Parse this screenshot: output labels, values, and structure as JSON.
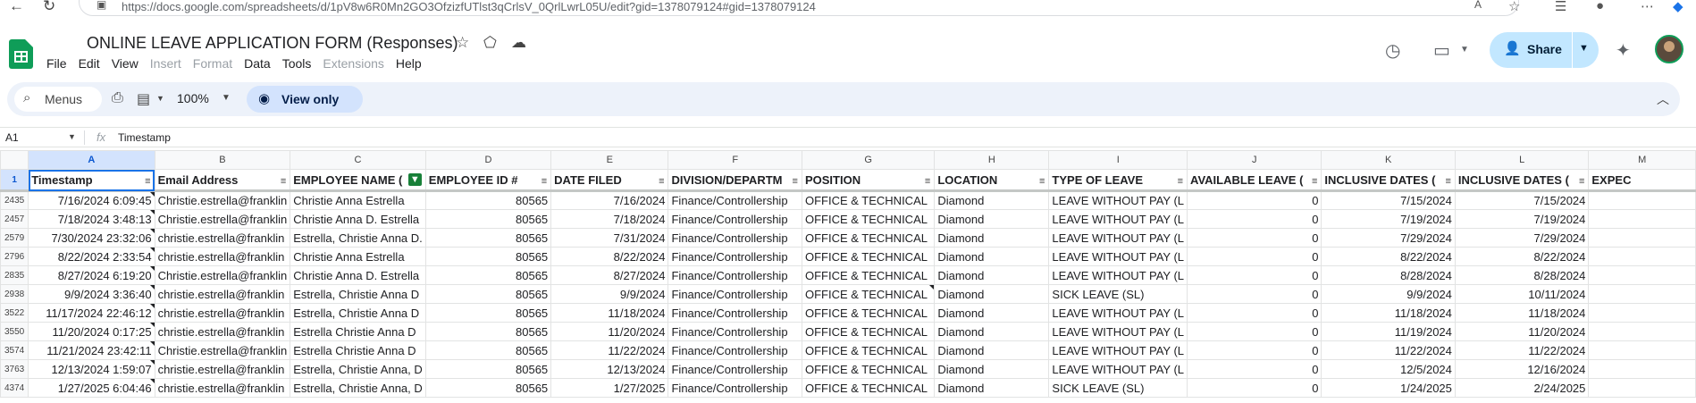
{
  "browser": {
    "url": "https://docs.google.com/spreadsheets/d/1pV8w6R0Mn2GO3OfzizfUTlst3qCrlsV_0QrlLwrL05U/edit?gid=1378079124#gid=1378079124"
  },
  "header": {
    "title": "ONLINE LEAVE APPLICATION FORM (Responses)",
    "menus": [
      "File",
      "Edit",
      "View",
      "Insert",
      "Format",
      "Data",
      "Tools",
      "Extensions",
      "Help"
    ],
    "disabled_menus": [
      "Insert",
      "Format",
      "Extensions"
    ],
    "share_label": "Share"
  },
  "toolbar": {
    "search_label": "Menus",
    "zoom": "100%",
    "view_only_label": "View only"
  },
  "formula_bar": {
    "name_box": "A1",
    "fx_label": "fx",
    "value": "Timestamp"
  },
  "sheet": {
    "columns": [
      "A",
      "B",
      "C",
      "D",
      "E",
      "F",
      "G",
      "H",
      "I",
      "J",
      "K",
      "L",
      "M"
    ],
    "header_row_number": "1",
    "headers": [
      "Timestamp",
      "Email Address",
      "EMPLOYEE NAME (",
      "EMPLOYEE ID #",
      "DATE FILED",
      "DIVISION/DEPARTM",
      "POSITION",
      "LOCATION",
      "TYPE OF LEAVE",
      "AVAILABLE LEAVE (",
      "INCLUSIVE DATES (",
      "INCLUSIVE DATES (",
      "EXPEC"
    ],
    "rows": [
      {
        "num": "2435",
        "cells": [
          "7/16/2024 6:09:45",
          "Christie.estrella@franklin",
          "Christie Anna Estrella",
          "80565",
          "7/16/2024",
          "Finance/Controllership",
          "OFFICE & TECHNICAL",
          "Diamond",
          "LEAVE WITHOUT PAY (L",
          "0",
          "7/15/2024",
          "7/15/2024",
          ""
        ]
      },
      {
        "num": "2457",
        "cells": [
          "7/18/2024 3:48:13",
          "Christie.estrella@franklin",
          "Christie Anna D. Estrella",
          "80565",
          "7/18/2024",
          "Finance/Controllership",
          "OFFICE & TECHNICAL",
          "Diamond",
          "LEAVE WITHOUT PAY (L",
          "0",
          "7/19/2024",
          "7/19/2024",
          ""
        ]
      },
      {
        "num": "2579",
        "cells": [
          "7/30/2024 23:32:06",
          "christie.estrella@franklin",
          "Estrella, Christie Anna D.",
          "80565",
          "7/31/2024",
          "Finance/Controllership",
          "OFFICE & TECHNICAL",
          "Diamond",
          "LEAVE WITHOUT PAY (L",
          "0",
          "7/29/2024",
          "7/29/2024",
          ""
        ]
      },
      {
        "num": "2796",
        "cells": [
          "8/22/2024 2:33:54",
          "christie.estrella@franklin",
          "Christie Anna Estrella",
          "80565",
          "8/22/2024",
          "Finance/Controllership",
          "OFFICE & TECHNICAL",
          "Diamond",
          "LEAVE WITHOUT PAY (L",
          "0",
          "8/22/2024",
          "8/22/2024",
          ""
        ]
      },
      {
        "num": "2835",
        "cells": [
          "8/27/2024 6:19:20",
          "Christie.estrella@franklin",
          "Christie Anna D. Estrella",
          "80565",
          "8/27/2024",
          "Finance/Controllership",
          "OFFICE & TECHNICAL",
          "Diamond",
          "LEAVE WITHOUT PAY (L",
          "0",
          "8/28/2024",
          "8/28/2024",
          ""
        ]
      },
      {
        "num": "2938",
        "cells": [
          "9/9/2024 3:36:40",
          "christie.estrella@franklin",
          "Estrella, Christie Anna D",
          "80565",
          "9/9/2024",
          "Finance/Controllership",
          "OFFICE & TECHNICAL",
          "Diamond",
          "SICK LEAVE (SL)",
          "0",
          "9/9/2024",
          "10/11/2024",
          ""
        ]
      },
      {
        "num": "3522",
        "cells": [
          "11/17/2024 22:46:12",
          "christie.estrella@franklin",
          "Estrella, Christie Anna D",
          "80565",
          "11/18/2024",
          "Finance/Controllership",
          "OFFICE & TECHNICAL",
          "Diamond",
          "LEAVE WITHOUT PAY (L",
          "0",
          "11/18/2024",
          "11/18/2024",
          ""
        ]
      },
      {
        "num": "3550",
        "cells": [
          "11/20/2024 0:17:25",
          "christie.estrella@franklin",
          "Estrella Christie Anna D",
          "80565",
          "11/20/2024",
          "Finance/Controllership",
          "OFFICE & TECHNICAL",
          "Diamond",
          "LEAVE WITHOUT PAY (L",
          "0",
          "11/19/2024",
          "11/20/2024",
          ""
        ]
      },
      {
        "num": "3574",
        "cells": [
          "11/21/2024 23:42:11",
          "Christie.estrella@franklin",
          "Estrella Christie Anna D",
          "80565",
          "11/22/2024",
          "Finance/Controllership",
          "OFFICE & TECHNICAL",
          "Diamond",
          "LEAVE WITHOUT PAY (L",
          "0",
          "11/22/2024",
          "11/22/2024",
          ""
        ]
      },
      {
        "num": "3763",
        "cells": [
          "12/13/2024 1:59:07",
          "christie.estrella@franklin",
          "Estrella, Christie Anna, D",
          "80565",
          "12/13/2024",
          "Finance/Controllership",
          "OFFICE & TECHNICAL",
          "Diamond",
          "LEAVE WITHOUT PAY (L",
          "0",
          "12/5/2024",
          "12/16/2024",
          ""
        ]
      },
      {
        "num": "4374",
        "cells": [
          "1/27/2025 6:04:46",
          "christie.estrella@franklin",
          "Estrella, Christie Anna, D",
          "80565",
          "1/27/2025",
          "Finance/Controllership",
          "OFFICE & TECHNICAL",
          "Diamond",
          "SICK LEAVE (SL)",
          "0",
          "1/24/2025",
          "2/24/2025",
          ""
        ]
      }
    ]
  }
}
